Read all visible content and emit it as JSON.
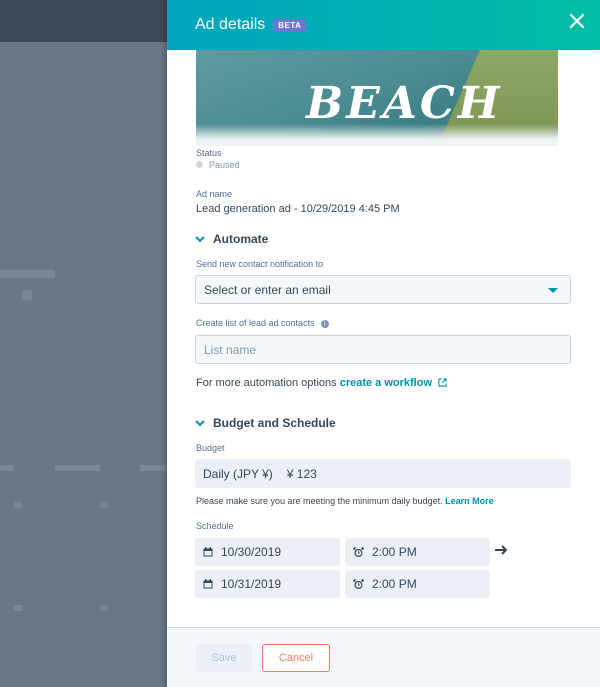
{
  "panel": {
    "title": "Ad details",
    "badge": "BETA",
    "close_icon": "close-icon"
  },
  "ad_image": {
    "text": "BEACH"
  },
  "status": {
    "label": "Status",
    "value": "Paused"
  },
  "ad_name": {
    "label": "Ad name",
    "value": "Lead generation ad - 10/29/2019 4:45 PM"
  },
  "automate": {
    "heading": "Automate",
    "notify_label": "Send new contact notification to",
    "notify_placeholder": "Select or enter an email",
    "list_label": "Create list of lead ad contacts",
    "list_placeholder": "List name",
    "automation_text": "For more automation options",
    "workflow_link": "create a workflow"
  },
  "budget": {
    "heading": "Budget and Schedule",
    "label": "Budget",
    "type": "Daily (JPY ¥)",
    "amount": "¥ 123",
    "notice": "Please make sure you are meeting the minimum daily budget.",
    "learn_more": "Learn More"
  },
  "schedule": {
    "label": "Schedule",
    "start_date": "10/30/2019",
    "start_time": "2:00 PM",
    "end_date": "10/31/2019",
    "end_time": "2:00 PM"
  },
  "footer": {
    "save_label": "Save",
    "cancel_label": "Cancel"
  },
  "colors": {
    "header_start": "#00a4bd",
    "header_end": "#00bda5",
    "link": "#0091ae",
    "cancel": "#ff7a59",
    "badge": "#6a78d1"
  }
}
